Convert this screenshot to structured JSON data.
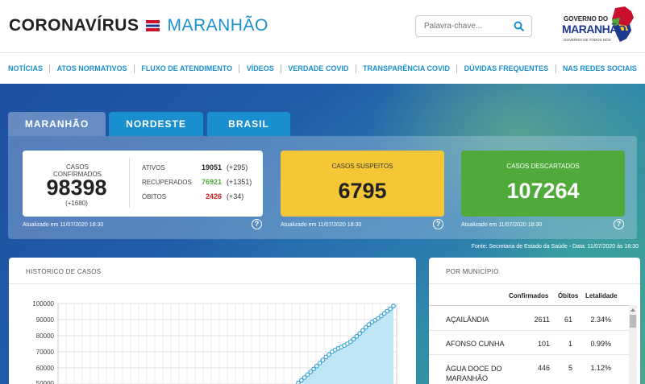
{
  "header": {
    "title_part1": "CORONAVÍRUS",
    "title_part2": "MARANHÃO",
    "search_placeholder": "Palavra-chave...",
    "logo_line1": "GOVERNO DO",
    "logo_line2": "MARANHÃO",
    "logo_line3": "GOVERNO DE TODOS NÓS"
  },
  "nav": [
    "NOTÍCIAS",
    "ATOS NORMATIVOS",
    "FLUXO DE ATENDIMENTO",
    "VÍDEOS",
    "VERDADE COVID",
    "TRANSPARÊNCIA COVID",
    "DÚVIDAS FREQUENTES",
    "NAS REDES SOCIAIS"
  ],
  "tabs": [
    "MARANHÃO",
    "NORDESTE",
    "BRASIL"
  ],
  "cards": {
    "confirmed_label": "CASOS CONFIRMADOS",
    "confirmed_value": "98398",
    "confirmed_delta": "(+1680)",
    "stats": [
      {
        "label": "ATIVOS",
        "value": "19051",
        "delta": "(+295)",
        "color": "#222222"
      },
      {
        "label": "RECUPERADOS",
        "value": "76921",
        "delta": "(+1351)",
        "color": "#4faa3a"
      },
      {
        "label": "ÓBITOS",
        "value": "2426",
        "delta": "(+34)",
        "color": "#d0211c"
      }
    ],
    "suspect_label": "CASOS SUSPEITOS",
    "suspect_value": "6795",
    "discarded_label": "CASOS DESCARTADOS",
    "discarded_value": "107264",
    "updated": "Atualizado em 11/07/2020 18:30",
    "help_symbol": "?",
    "colors": {
      "suspect": "#f5c737",
      "discarded": "#4faa3a",
      "accent": "#1a8fd0"
    }
  },
  "source": "Fonte: Secretaria de Estado da Saúde - Data: 11/07/2020 às 18:30",
  "history": {
    "title": "HISTÓRICO DE CASOS",
    "y_ticks": [
      "100000",
      "90000",
      "80000",
      "70000",
      "60000",
      "50000"
    ]
  },
  "chart_data": {
    "type": "area",
    "title": "HISTÓRICO DE CASOS",
    "xlabel": "",
    "ylabel": "",
    "ylim": [
      50000,
      100000
    ],
    "grid": true,
    "y": [
      50600,
      52300,
      54000,
      55800,
      57500,
      59300,
      61100,
      63000,
      64900,
      66800,
      68200,
      70000,
      71200,
      72100,
      73000,
      73900,
      75000,
      76300,
      77800,
      79600,
      81400,
      83300,
      85200,
      86900,
      88400,
      89600,
      90700,
      92300,
      93800,
      95300,
      96700,
      98398
    ]
  },
  "municipios": {
    "title": "POR MUNICÍPIO",
    "columns": [
      "Confirmados",
      "Óbitos",
      "Letalidade"
    ],
    "rows": [
      {
        "name": "AÇAILÂNDIA",
        "confirmed": "2611",
        "deaths": "61",
        "lethality": "2.34%"
      },
      {
        "name": "AFONSO CUNHA",
        "confirmed": "101",
        "deaths": "1",
        "lethality": "0.99%"
      },
      {
        "name": "ÁGUA DOCE DO MARANHÃO",
        "confirmed": "446",
        "deaths": "5",
        "lethality": "1.12%"
      }
    ]
  }
}
